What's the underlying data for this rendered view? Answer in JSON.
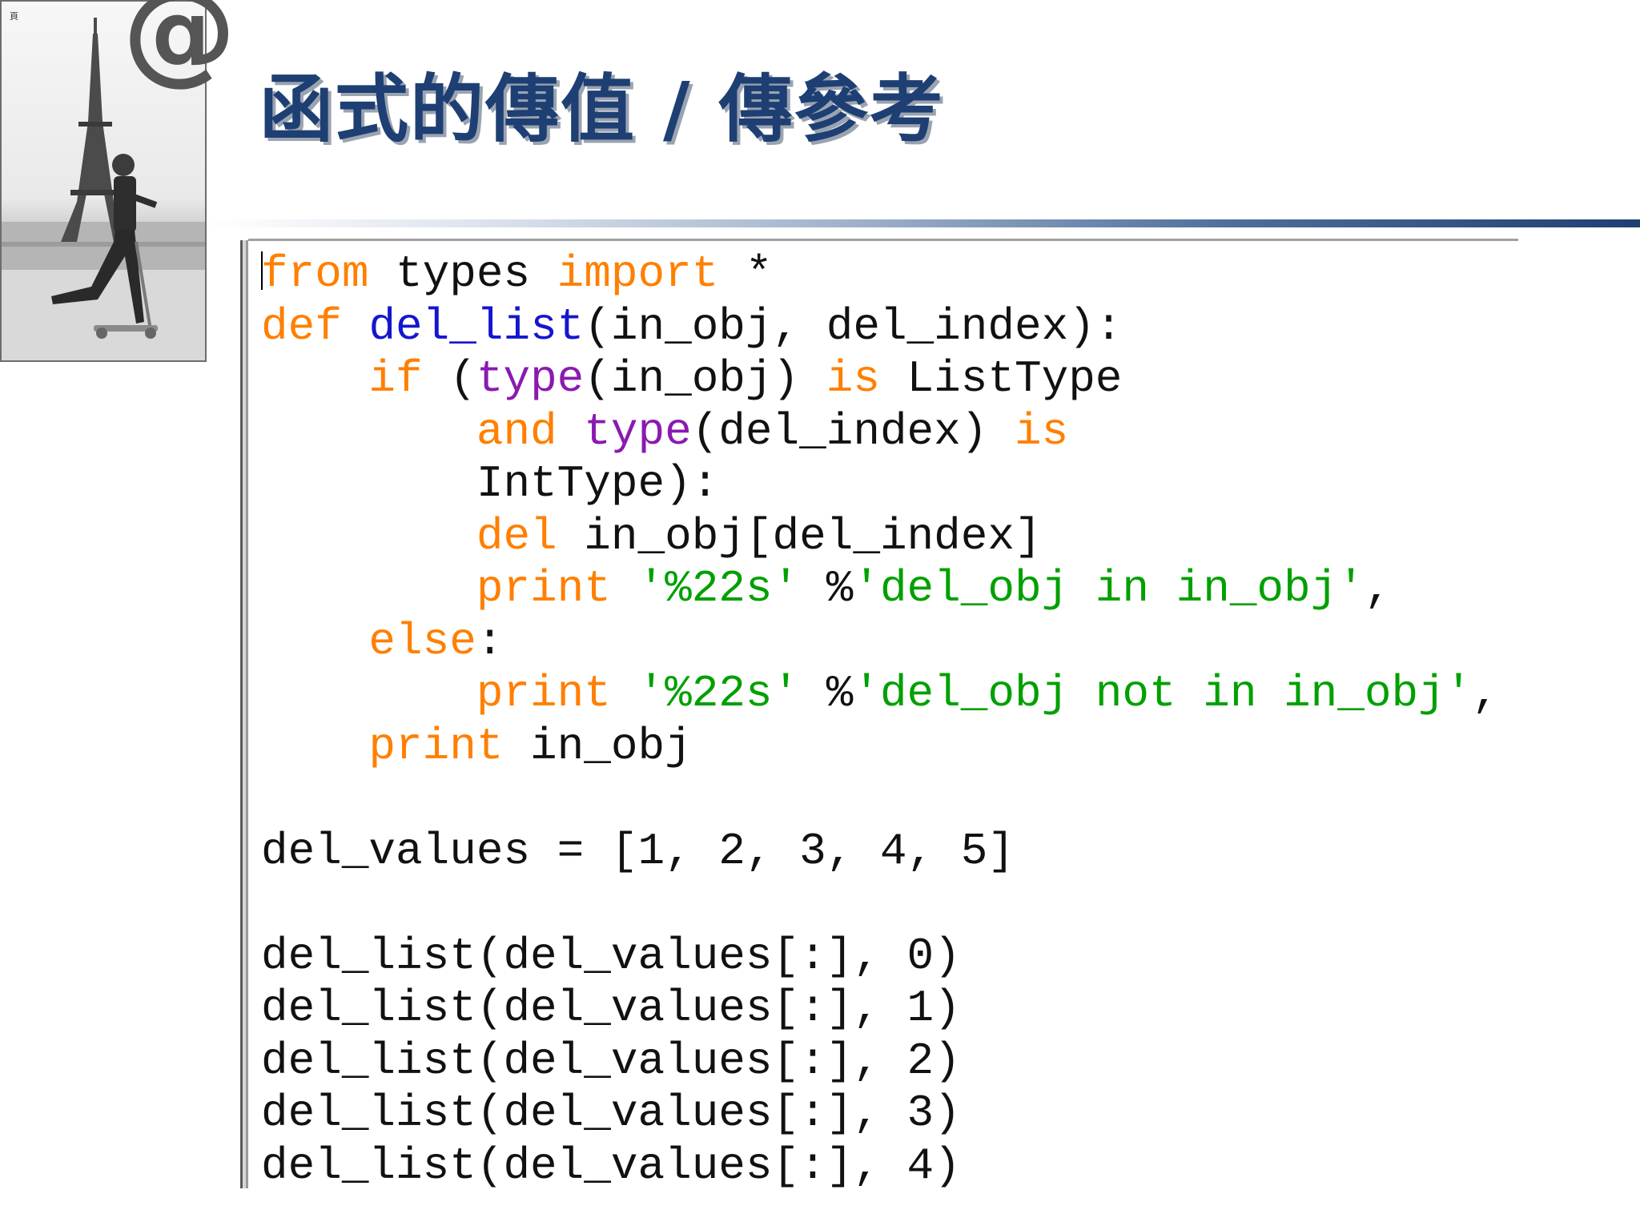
{
  "slide": {
    "title": "函式的傳值 / 傳參考",
    "tiny_mark": "頁",
    "logo_symbol": "@"
  },
  "colors": {
    "title": "#1e3f73",
    "keyword": "#ff7f00",
    "function_name": "#1515d0",
    "builtin": "#8a1ab0",
    "string": "#00a000",
    "plain": "#111111"
  },
  "code": {
    "lines": [
      [
        {
          "t": "from",
          "c": "kw"
        },
        {
          "t": " types ",
          "c": "pl"
        },
        {
          "t": "import",
          "c": "kw"
        },
        {
          "t": " *",
          "c": "pl"
        }
      ],
      [
        {
          "t": "def",
          "c": "kw"
        },
        {
          "t": " ",
          "c": "pl"
        },
        {
          "t": "del_list",
          "c": "fn"
        },
        {
          "t": "(in_obj, del_index):",
          "c": "pl"
        }
      ],
      [
        {
          "t": "    ",
          "c": "pl"
        },
        {
          "t": "if",
          "c": "kw"
        },
        {
          "t": " (",
          "c": "pl"
        },
        {
          "t": "type",
          "c": "bi"
        },
        {
          "t": "(in_obj) ",
          "c": "pl"
        },
        {
          "t": "is",
          "c": "kw"
        },
        {
          "t": " ListType",
          "c": "pl"
        }
      ],
      [
        {
          "t": "        ",
          "c": "pl"
        },
        {
          "t": "and",
          "c": "kw"
        },
        {
          "t": " ",
          "c": "pl"
        },
        {
          "t": "type",
          "c": "bi"
        },
        {
          "t": "(del_index) ",
          "c": "pl"
        },
        {
          "t": "is",
          "c": "kw"
        }
      ],
      [
        {
          "t": "        IntType):",
          "c": "pl"
        }
      ],
      [
        {
          "t": "        ",
          "c": "pl"
        },
        {
          "t": "del",
          "c": "kw"
        },
        {
          "t": " in_obj[del_index]",
          "c": "pl"
        }
      ],
      [
        {
          "t": "        ",
          "c": "pl"
        },
        {
          "t": "print",
          "c": "kw"
        },
        {
          "t": " ",
          "c": "pl"
        },
        {
          "t": "'%22s'",
          "c": "st"
        },
        {
          "t": " %",
          "c": "pl"
        },
        {
          "t": "'del_obj in in_obj'",
          "c": "st"
        },
        {
          "t": ",",
          "c": "pl"
        }
      ],
      [
        {
          "t": "    ",
          "c": "pl"
        },
        {
          "t": "else",
          "c": "kw"
        },
        {
          "t": ":",
          "c": "pl"
        }
      ],
      [
        {
          "t": "        ",
          "c": "pl"
        },
        {
          "t": "print",
          "c": "kw"
        },
        {
          "t": " ",
          "c": "pl"
        },
        {
          "t": "'%22s'",
          "c": "st"
        },
        {
          "t": " %",
          "c": "pl"
        },
        {
          "t": "'del_obj not in in_obj'",
          "c": "st"
        },
        {
          "t": ",",
          "c": "pl"
        }
      ],
      [
        {
          "t": "    ",
          "c": "pl"
        },
        {
          "t": "print",
          "c": "kw"
        },
        {
          "t": " in_obj",
          "c": "pl"
        }
      ],
      [
        {
          "t": "",
          "c": "pl"
        }
      ],
      [
        {
          "t": "del_values = [1, 2, 3, 4, 5]",
          "c": "pl"
        }
      ],
      [
        {
          "t": "",
          "c": "pl"
        }
      ],
      [
        {
          "t": "del_list(del_values[:], 0)",
          "c": "pl"
        }
      ],
      [
        {
          "t": "del_list(del_values[:], 1)",
          "c": "pl"
        }
      ],
      [
        {
          "t": "del_list(del_values[:], 2)",
          "c": "pl"
        }
      ],
      [
        {
          "t": "del_list(del_values[:], 3)",
          "c": "pl"
        }
      ],
      [
        {
          "t": "del_list(del_values[:], 4)",
          "c": "pl"
        }
      ]
    ]
  }
}
